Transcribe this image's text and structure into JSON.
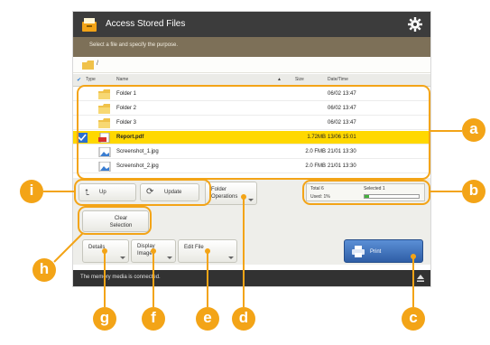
{
  "app": {
    "title": "Access Stored Files",
    "instruction": "Select a file and specify the purpose.",
    "path": "/"
  },
  "list": {
    "columns": [
      "Type",
      "Name",
      "Size",
      "Date/Time"
    ],
    "rows": [
      {
        "name": "Folder 1",
        "size": "",
        "date": "06/02 13:47",
        "type": "folder",
        "selected": false
      },
      {
        "name": "Folder 2",
        "size": "",
        "date": "06/02 13:47",
        "type": "folder",
        "selected": false
      },
      {
        "name": "Folder 3",
        "size": "",
        "date": "06/02 13:47",
        "type": "folder",
        "selected": false
      },
      {
        "name": "Report.pdf",
        "size": "1.72MB",
        "date": "13/06 15:01",
        "type": "pdf",
        "selected": true
      },
      {
        "name": "Screenshot_1.jpg",
        "size": "2.0 FMB",
        "date": "21/01 13:30",
        "type": "image",
        "selected": false
      },
      {
        "name": "Screenshot_2.jpg",
        "size": "2.0 FMB",
        "date": "21/01 13:30",
        "type": "image",
        "selected": false
      }
    ]
  },
  "toolbar": {
    "up": "Up",
    "update": "Update",
    "folder_ops": "Folder Operations",
    "clear_selection": "Clear Selection",
    "details": "Details",
    "display_image": "Display Image",
    "edit_file": "Edit File",
    "print": "Print"
  },
  "info": {
    "total": "Total 6",
    "selected": "Selected 1",
    "used": "Used: 1%",
    "used_fraction": 0.08
  },
  "status": "The memory media is connected.",
  "callouts": [
    "a",
    "b",
    "c",
    "d",
    "e",
    "f",
    "g",
    "h",
    "i"
  ],
  "colors": {
    "accent": "#f3a417",
    "selected_row": "#ffd800",
    "title_bar": "#3c3c3c",
    "instruction_bar": "#7d7058",
    "print_button": "#2f5ea6"
  },
  "icons": {
    "app": "file-cabinet-icon",
    "settings": "gear-icon",
    "folder": "folder-icon",
    "pdf": "pdf-icon",
    "image": "image-icon",
    "up": "up-arrow-icon",
    "update": "refresh-icon",
    "print": "printer-icon"
  }
}
